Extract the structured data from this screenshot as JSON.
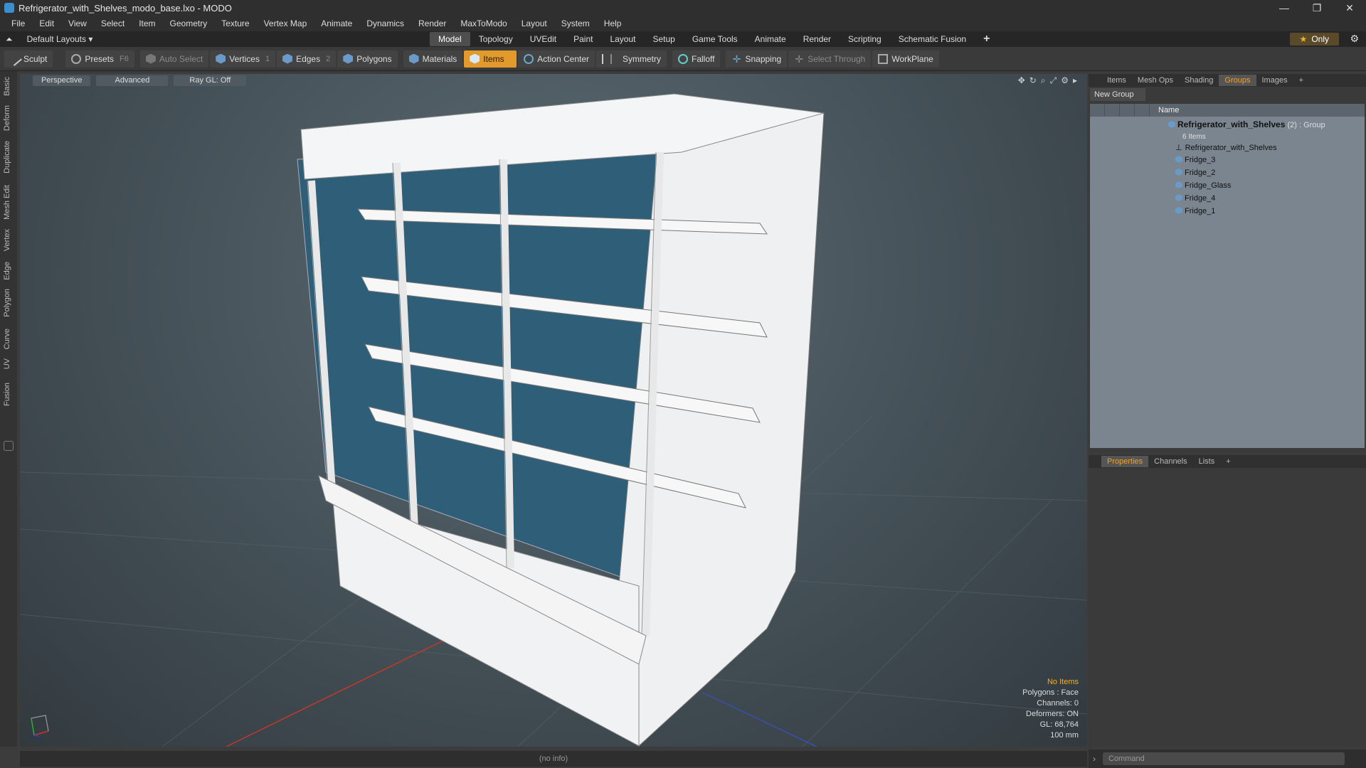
{
  "window": {
    "title": "Refrigerator_with_Shelves_modo_base.lxo - MODO"
  },
  "menu": [
    "File",
    "Edit",
    "View",
    "Select",
    "Item",
    "Geometry",
    "Texture",
    "Vertex Map",
    "Animate",
    "Dynamics",
    "Render",
    "MaxToModo",
    "Layout",
    "System",
    "Help"
  ],
  "layout": {
    "name": "Default Layouts",
    "tabs": [
      "Model",
      "Topology",
      "UVEdit",
      "Paint",
      "Layout",
      "Setup",
      "Game Tools",
      "Animate",
      "Render",
      "Scripting",
      "Schematic Fusion"
    ],
    "active_tab": "Model",
    "only_label": "Only"
  },
  "toolbar": {
    "sculpt": "Sculpt",
    "presets": "Presets",
    "presets_key": "F6",
    "auto_select": "Auto Select",
    "vertices": "Vertices",
    "vertices_key": "1",
    "edges": "Edges",
    "edges_key": "2",
    "polygons": "Polygons",
    "materials": "Materials",
    "items": "Items",
    "action_center": "Action Center",
    "symmetry": "Symmetry",
    "falloff": "Falloff",
    "snapping": "Snapping",
    "select_through": "Select Through",
    "workplane": "WorkPlane"
  },
  "left_tabs": [
    "Basic",
    "Deform",
    "Duplicate",
    "Mesh Edit",
    "Vertex",
    "Edge",
    "Polygon",
    "Curve",
    "UV",
    "Fusion"
  ],
  "viewport": {
    "view": "Perspective",
    "shading": "Advanced",
    "raygl": "Ray GL: Off",
    "info": {
      "items": "No Items",
      "polygons": "Polygons : Face",
      "channels": "Channels: 0",
      "deformers": "Deformers: ON",
      "gl": "GL: 68,764",
      "unit": "100 mm"
    }
  },
  "status": "(no info)",
  "right_panel": {
    "tabs": [
      "Items",
      "Mesh Ops",
      "Shading",
      "Groups",
      "Images"
    ],
    "active_tab": "Groups",
    "new_group": "New Group",
    "name_header": "Name",
    "group": {
      "name": "Refrigerator_with_Shelves",
      "meta": "(2) : Group",
      "count": "6 Items"
    },
    "children": [
      "Refrigerator_with_Shelves",
      "Fridge_3",
      "Fridge_2",
      "Fridge_Glass",
      "Fridge_4",
      "Fridge_1"
    ]
  },
  "bottom_panel": {
    "tabs": [
      "Properties",
      "Channels",
      "Lists"
    ],
    "active_tab": "Properties"
  },
  "command": {
    "placeholder": "Command"
  }
}
